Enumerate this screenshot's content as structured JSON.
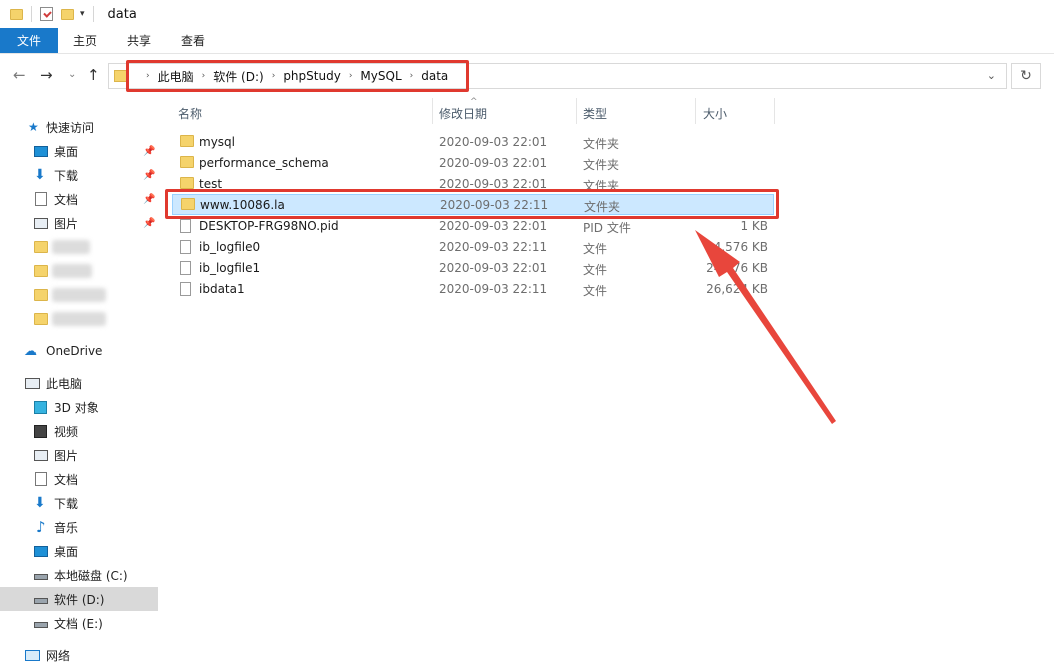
{
  "window": {
    "title": "data"
  },
  "ribbon": {
    "tabs": [
      "文件",
      "主页",
      "共享",
      "查看"
    ]
  },
  "address": {
    "crumbs": [
      "此电脑",
      "软件 (D:)",
      "phpStudy",
      "MySQL",
      "data"
    ]
  },
  "sidebar": {
    "quick_access": "快速访问",
    "quick_items": [
      "桌面",
      "下载",
      "文档",
      "图片"
    ],
    "onedrive": "OneDrive",
    "this_pc": "此电脑",
    "pc_items": [
      "3D 对象",
      "视频",
      "图片",
      "文档",
      "下载",
      "音乐",
      "桌面",
      "本地磁盘 (C:)",
      "软件 (D:)",
      "文档 (E:)"
    ],
    "network": "网络"
  },
  "columns": {
    "name": "名称",
    "date": "修改日期",
    "type": "类型",
    "size": "大小"
  },
  "files": [
    {
      "name": "mysql",
      "date": "2020-09-03 22:01",
      "type": "文件夹",
      "size": "",
      "icon": "folder-icon"
    },
    {
      "name": "performance_schema",
      "date": "2020-09-03 22:01",
      "type": "文件夹",
      "size": "",
      "icon": "folder-icon"
    },
    {
      "name": "test",
      "date": "2020-09-03 22:01",
      "type": "文件夹",
      "size": "",
      "icon": "folder-icon"
    },
    {
      "name": "www.10086.la",
      "date": "2020-09-03 22:11",
      "type": "文件夹",
      "size": "",
      "icon": "folder-icon"
    },
    {
      "name": "DESKTOP-FRG98NO.pid",
      "date": "2020-09-03 22:01",
      "type": "PID 文件",
      "size": "1 KB",
      "icon": "file-icon"
    },
    {
      "name": "ib_logfile0",
      "date": "2020-09-03 22:11",
      "type": "文件",
      "size": "4,576 KB",
      "icon": "file-icon"
    },
    {
      "name": "ib_logfile1",
      "date": "2020-09-03 22:01",
      "type": "文件",
      "size": "24,576 KB",
      "icon": "file-icon"
    },
    {
      "name": "ibdata1",
      "date": "2020-09-03 22:11",
      "type": "文件",
      "size": "26,624 KB",
      "icon": "file-icon"
    }
  ],
  "colors": {
    "accent": "#1979ca",
    "annotation": "#e0392f",
    "selection": "#cce8ff"
  }
}
